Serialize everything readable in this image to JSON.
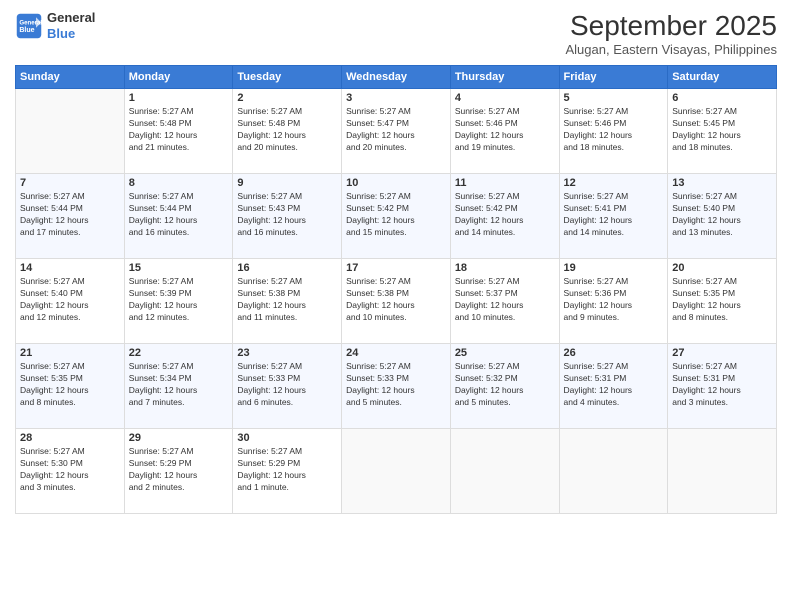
{
  "header": {
    "logo_line1": "General",
    "logo_line2": "Blue",
    "month": "September 2025",
    "location": "Alugan, Eastern Visayas, Philippines"
  },
  "days": [
    "Sunday",
    "Monday",
    "Tuesday",
    "Wednesday",
    "Thursday",
    "Friday",
    "Saturday"
  ],
  "weeks": [
    [
      {
        "day": "",
        "content": ""
      },
      {
        "day": "1",
        "content": "Sunrise: 5:27 AM\nSunset: 5:48 PM\nDaylight: 12 hours\nand 21 minutes."
      },
      {
        "day": "2",
        "content": "Sunrise: 5:27 AM\nSunset: 5:48 PM\nDaylight: 12 hours\nand 20 minutes."
      },
      {
        "day": "3",
        "content": "Sunrise: 5:27 AM\nSunset: 5:47 PM\nDaylight: 12 hours\nand 20 minutes."
      },
      {
        "day": "4",
        "content": "Sunrise: 5:27 AM\nSunset: 5:46 PM\nDaylight: 12 hours\nand 19 minutes."
      },
      {
        "day": "5",
        "content": "Sunrise: 5:27 AM\nSunset: 5:46 PM\nDaylight: 12 hours\nand 18 minutes."
      },
      {
        "day": "6",
        "content": "Sunrise: 5:27 AM\nSunset: 5:45 PM\nDaylight: 12 hours\nand 18 minutes."
      }
    ],
    [
      {
        "day": "7",
        "content": "Sunrise: 5:27 AM\nSunset: 5:44 PM\nDaylight: 12 hours\nand 17 minutes."
      },
      {
        "day": "8",
        "content": "Sunrise: 5:27 AM\nSunset: 5:44 PM\nDaylight: 12 hours\nand 16 minutes."
      },
      {
        "day": "9",
        "content": "Sunrise: 5:27 AM\nSunset: 5:43 PM\nDaylight: 12 hours\nand 16 minutes."
      },
      {
        "day": "10",
        "content": "Sunrise: 5:27 AM\nSunset: 5:42 PM\nDaylight: 12 hours\nand 15 minutes."
      },
      {
        "day": "11",
        "content": "Sunrise: 5:27 AM\nSunset: 5:42 PM\nDaylight: 12 hours\nand 14 minutes."
      },
      {
        "day": "12",
        "content": "Sunrise: 5:27 AM\nSunset: 5:41 PM\nDaylight: 12 hours\nand 14 minutes."
      },
      {
        "day": "13",
        "content": "Sunrise: 5:27 AM\nSunset: 5:40 PM\nDaylight: 12 hours\nand 13 minutes."
      }
    ],
    [
      {
        "day": "14",
        "content": "Sunrise: 5:27 AM\nSunset: 5:40 PM\nDaylight: 12 hours\nand 12 minutes."
      },
      {
        "day": "15",
        "content": "Sunrise: 5:27 AM\nSunset: 5:39 PM\nDaylight: 12 hours\nand 12 minutes."
      },
      {
        "day": "16",
        "content": "Sunrise: 5:27 AM\nSunset: 5:38 PM\nDaylight: 12 hours\nand 11 minutes."
      },
      {
        "day": "17",
        "content": "Sunrise: 5:27 AM\nSunset: 5:38 PM\nDaylight: 12 hours\nand 10 minutes."
      },
      {
        "day": "18",
        "content": "Sunrise: 5:27 AM\nSunset: 5:37 PM\nDaylight: 12 hours\nand 10 minutes."
      },
      {
        "day": "19",
        "content": "Sunrise: 5:27 AM\nSunset: 5:36 PM\nDaylight: 12 hours\nand 9 minutes."
      },
      {
        "day": "20",
        "content": "Sunrise: 5:27 AM\nSunset: 5:35 PM\nDaylight: 12 hours\nand 8 minutes."
      }
    ],
    [
      {
        "day": "21",
        "content": "Sunrise: 5:27 AM\nSunset: 5:35 PM\nDaylight: 12 hours\nand 8 minutes."
      },
      {
        "day": "22",
        "content": "Sunrise: 5:27 AM\nSunset: 5:34 PM\nDaylight: 12 hours\nand 7 minutes."
      },
      {
        "day": "23",
        "content": "Sunrise: 5:27 AM\nSunset: 5:33 PM\nDaylight: 12 hours\nand 6 minutes."
      },
      {
        "day": "24",
        "content": "Sunrise: 5:27 AM\nSunset: 5:33 PM\nDaylight: 12 hours\nand 5 minutes."
      },
      {
        "day": "25",
        "content": "Sunrise: 5:27 AM\nSunset: 5:32 PM\nDaylight: 12 hours\nand 5 minutes."
      },
      {
        "day": "26",
        "content": "Sunrise: 5:27 AM\nSunset: 5:31 PM\nDaylight: 12 hours\nand 4 minutes."
      },
      {
        "day": "27",
        "content": "Sunrise: 5:27 AM\nSunset: 5:31 PM\nDaylight: 12 hours\nand 3 minutes."
      }
    ],
    [
      {
        "day": "28",
        "content": "Sunrise: 5:27 AM\nSunset: 5:30 PM\nDaylight: 12 hours\nand 3 minutes."
      },
      {
        "day": "29",
        "content": "Sunrise: 5:27 AM\nSunset: 5:29 PM\nDaylight: 12 hours\nand 2 minutes."
      },
      {
        "day": "30",
        "content": "Sunrise: 5:27 AM\nSunset: 5:29 PM\nDaylight: 12 hours\nand 1 minute."
      },
      {
        "day": "",
        "content": ""
      },
      {
        "day": "",
        "content": ""
      },
      {
        "day": "",
        "content": ""
      },
      {
        "day": "",
        "content": ""
      }
    ]
  ]
}
